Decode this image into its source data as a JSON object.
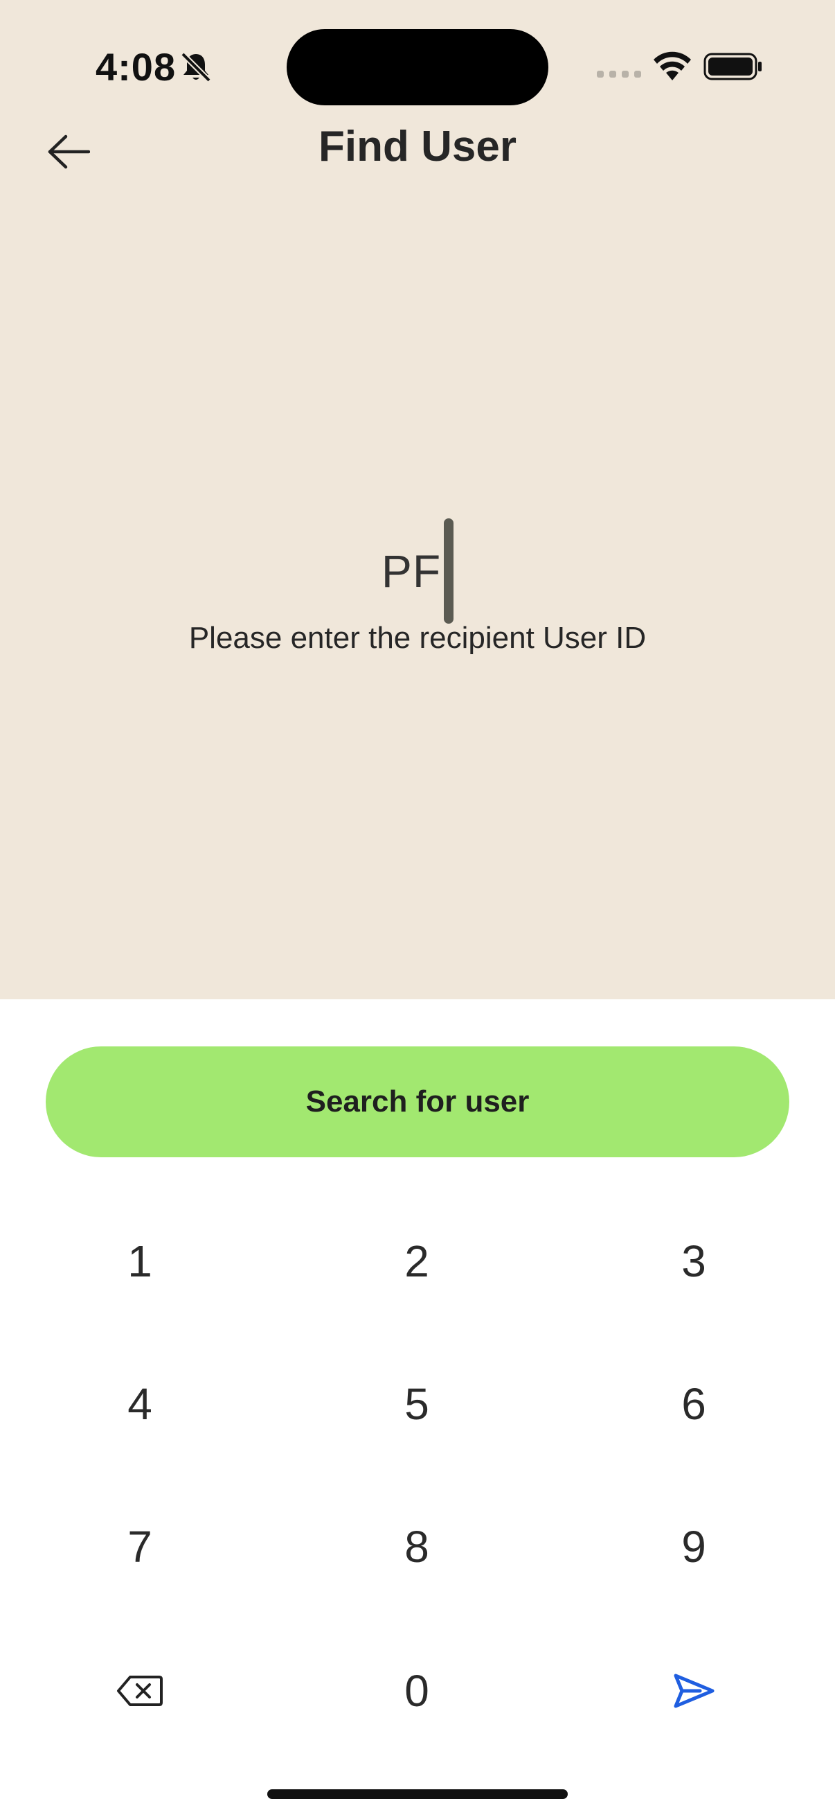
{
  "status_bar": {
    "time": "4:08",
    "icons": [
      "bell-slash-icon",
      "cellular-signal-icon",
      "wifi-icon",
      "battery-icon"
    ]
  },
  "header": {
    "back_icon": "arrow-left-icon",
    "title": "Find User"
  },
  "entry": {
    "value": "PF",
    "hint": "Please enter the recipient User ID"
  },
  "search_button": {
    "label": "Search for user"
  },
  "keypad": {
    "keys": [
      "1",
      "2",
      "3",
      "4",
      "5",
      "6",
      "7",
      "8",
      "9",
      "0"
    ],
    "delete_icon": "backspace-icon",
    "send_icon": "send-icon",
    "send_color": "#1f5ee0"
  },
  "colors": {
    "background_top": "#f0e7da",
    "button": "#a2e870"
  }
}
